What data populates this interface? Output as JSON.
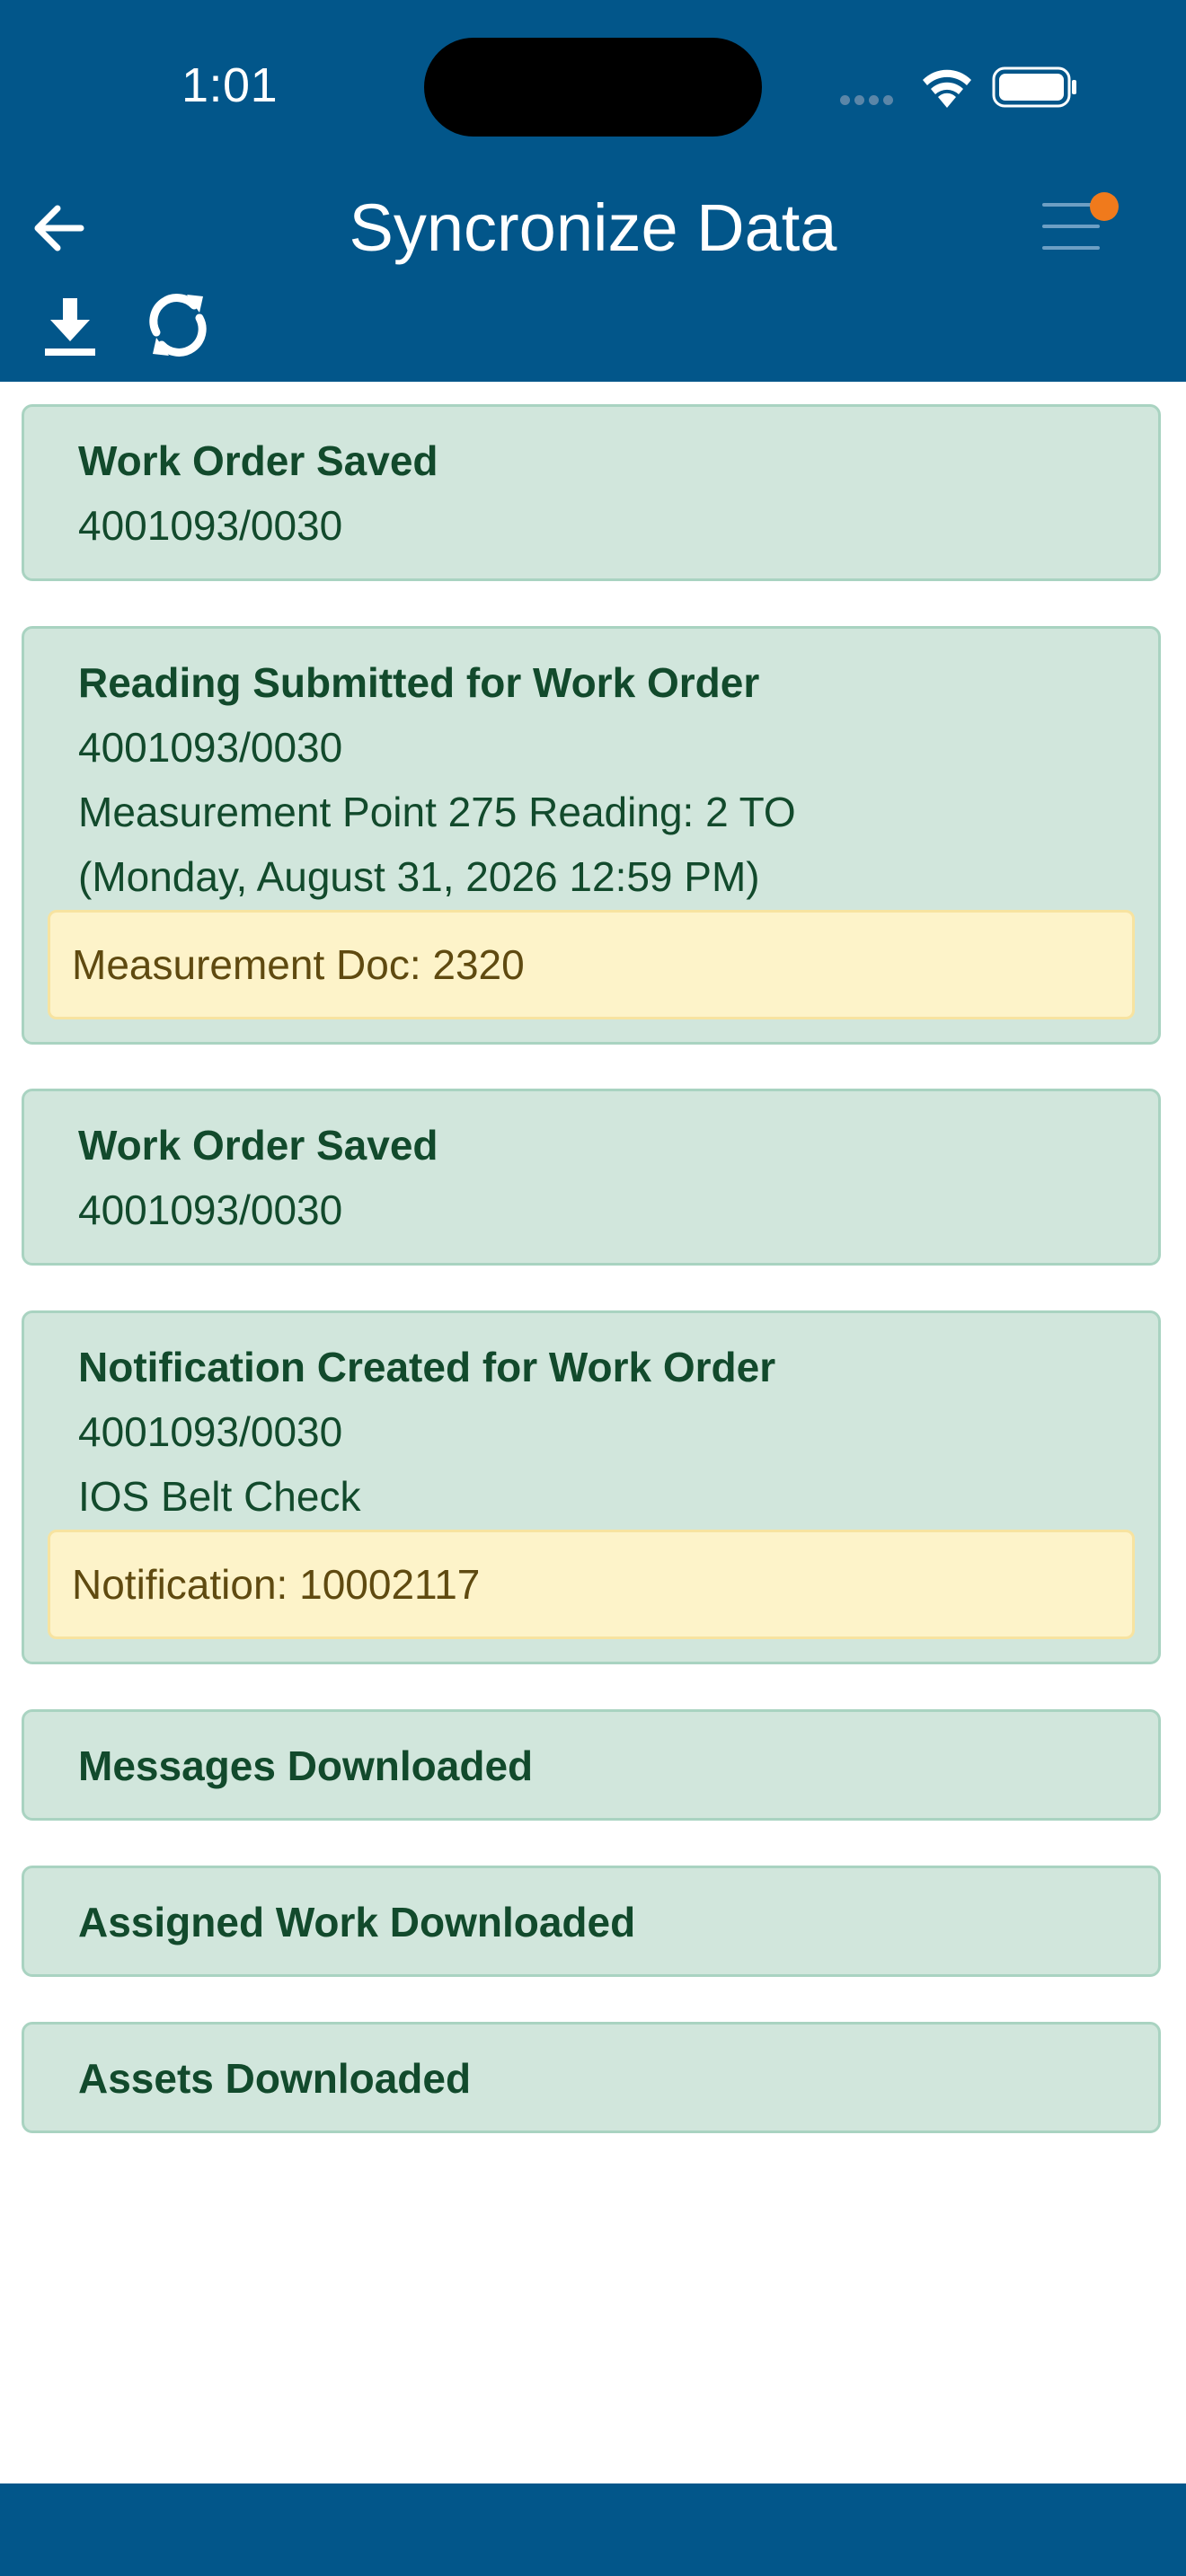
{
  "status_bar": {
    "time": "1:01"
  },
  "header": {
    "title": "Syncronize Data",
    "back_icon": "arrow-left-icon",
    "menu_icon": "hamburger-menu-icon",
    "download_icon": "download-icon",
    "sync_icon": "sync-icon",
    "accent_color": "#02568a",
    "badge_color": "#f07a1c"
  },
  "cards": [
    {
      "title": "Work Order Saved",
      "lines": [
        "4001093/0030"
      ]
    },
    {
      "title": "Reading Submitted for Work Order",
      "lines": [
        "4001093/0030",
        "Measurement Point 275 Reading: 2 TO",
        "(Monday, August 31, 2026 12:59 PM)"
      ],
      "note": "Measurement Doc: 2320"
    },
    {
      "title": "Work Order Saved",
      "lines": [
        "4001093/0030"
      ]
    },
    {
      "title": "Notification Created for Work Order",
      "lines": [
        "4001093/0030",
        "IOS Belt Check"
      ],
      "note": "Notification: 10002117"
    },
    {
      "title": "Messages Downloaded",
      "lines": []
    },
    {
      "title": "Assigned Work Downloaded",
      "lines": []
    },
    {
      "title": "Assets Downloaded",
      "lines": []
    }
  ],
  "colors": {
    "card_background": "#d1e6dc",
    "card_text": "#124a2c",
    "note_background": "#fdf3c9",
    "note_text": "#5f4a10"
  }
}
